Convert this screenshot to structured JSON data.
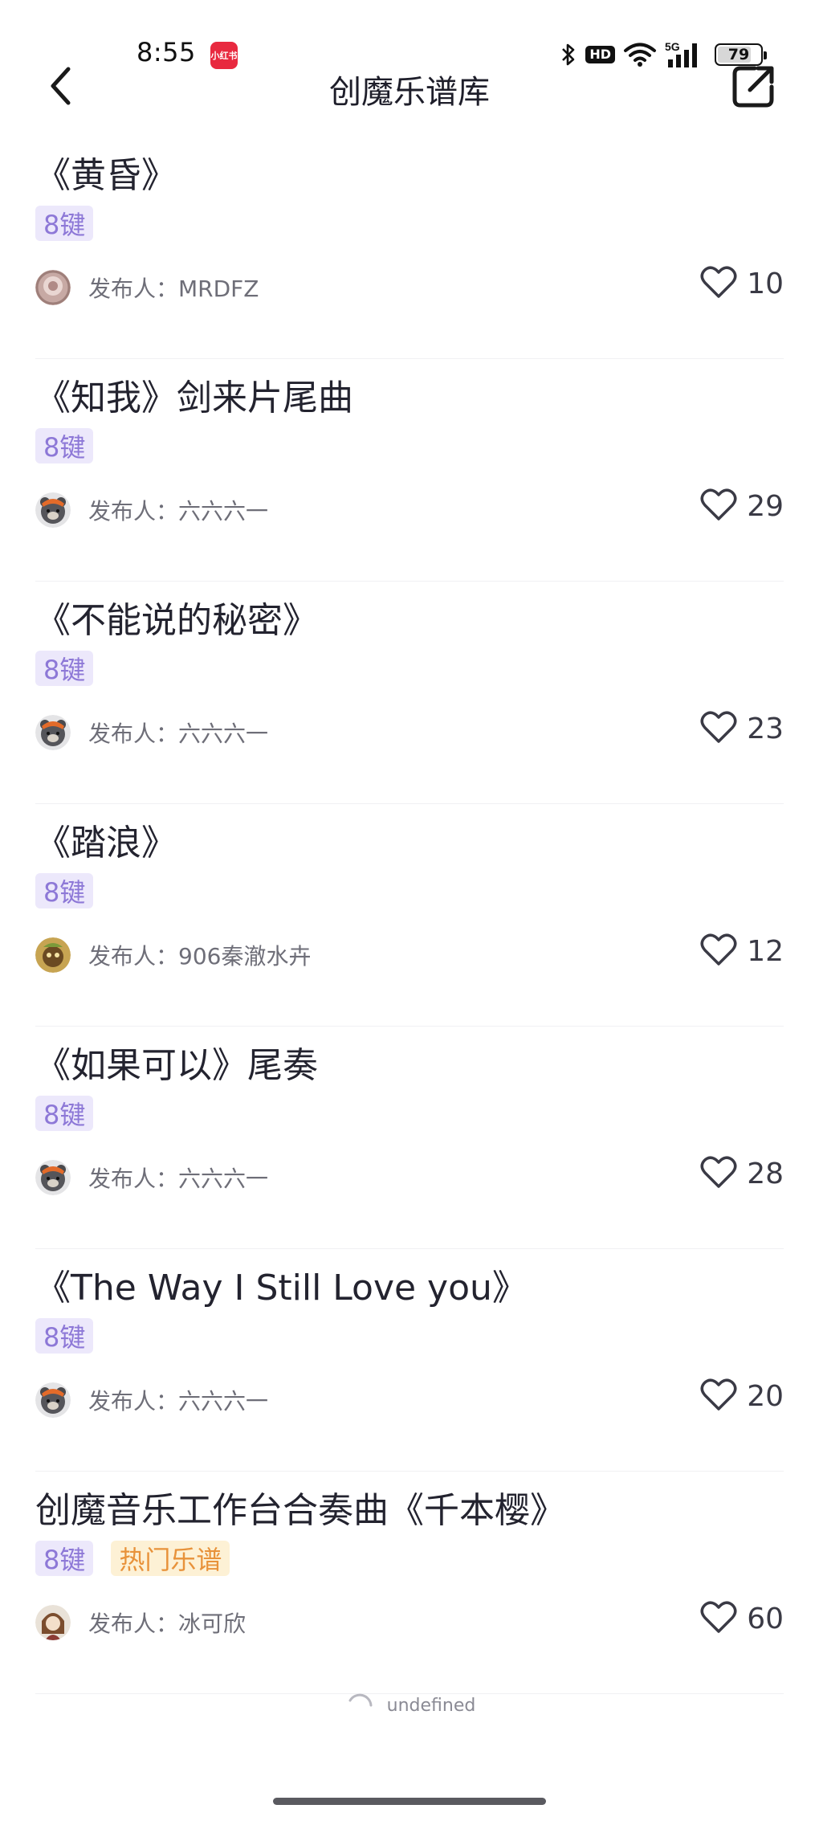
{
  "status_bar": {
    "time": "8:55",
    "app_badge": "小红书",
    "network": "5G",
    "hd": "HD",
    "battery": "79",
    "battery_level": 0.79
  },
  "nav": {
    "title": "创魔乐谱库"
  },
  "scores": [
    {
      "title": "《黄昏》",
      "tags": [
        "8键"
      ],
      "publisher": "发布人：MRDFZ",
      "likes": "10"
    },
    {
      "title": "《知我》剑来片尾曲",
      "tags": [
        "8键"
      ],
      "publisher": "发布人：六六六一",
      "likes": "29"
    },
    {
      "title": "《不能说的秘密》",
      "tags": [
        "8键"
      ],
      "publisher": "发布人：六六六一",
      "likes": "23"
    },
    {
      "title": "《踏浪》",
      "tags": [
        "8键"
      ],
      "publisher": "发布人：906秦澈水卉",
      "likes": "12"
    },
    {
      "title": "《如果可以》尾奏",
      "tags": [
        "8键"
      ],
      "publisher": "发布人：六六六一",
      "likes": "28"
    },
    {
      "title": "《The Way I Still Love you》",
      "tags": [
        "8键"
      ],
      "publisher": "发布人：六六六一",
      "likes": "20"
    },
    {
      "title": "创魔音乐工作台合奏曲《千本樱》",
      "tags": [
        "8键",
        "热门乐谱"
      ],
      "publisher": "发布人：冰可欣",
      "likes": "60"
    }
  ],
  "loading": {
    "text": "undefined"
  },
  "colors": {
    "tag_key_bg": "#ece8fb",
    "tag_key_text": "#8d78d7",
    "tag_hot_bg": "#fdf1d5",
    "tag_hot_text": "#e8923a",
    "app_badge": "#e8293f"
  }
}
